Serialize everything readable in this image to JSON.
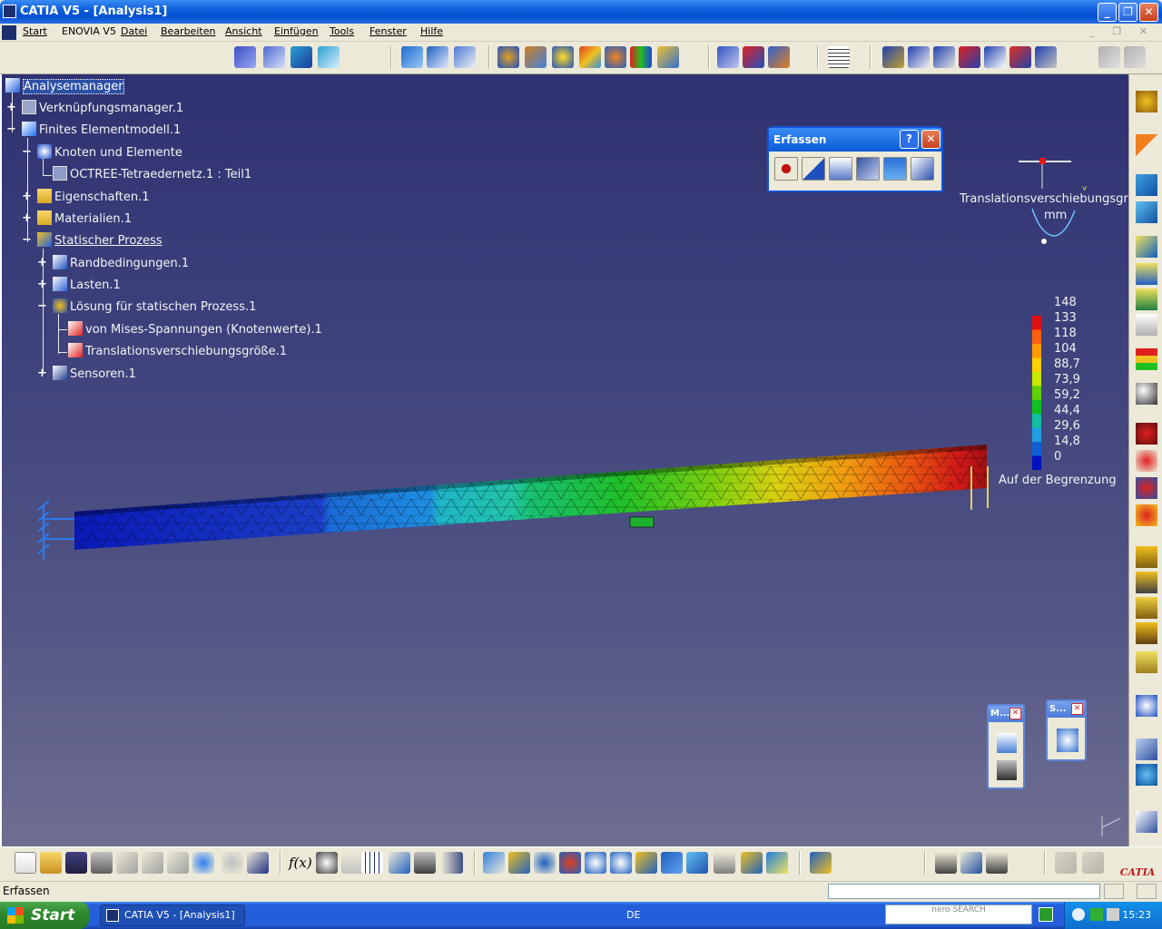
{
  "window": {
    "title": "CATIA V5 - [Analysis1]"
  },
  "menu": [
    "Start",
    "ENOVIA V5",
    "Datei",
    "Bearbeiten",
    "Ansicht",
    "Einfügen",
    "Tools",
    "Fenster",
    "Hilfe"
  ],
  "tree": [
    {
      "label": "Analysemanager",
      "icon": "analysis-manager-icon"
    },
    {
      "label": "Verknüpfungsmanager.1",
      "icon": "links-manager-icon"
    },
    {
      "label": "Finites Elementmodell.1",
      "icon": "fem-model-icon"
    },
    {
      "label": "Knoten und Elemente",
      "icon": "nodes-elements-icon"
    },
    {
      "label": "OCTREE-Tetraedernetz.1 : Teil1",
      "icon": "mesh-icon"
    },
    {
      "label": "Eigenschaften.1",
      "icon": "folder-icon"
    },
    {
      "label": "Materialien.1",
      "icon": "folder-icon"
    },
    {
      "label": "Statischer Prozess",
      "icon": "static-case-icon"
    },
    {
      "label": "Randbedingungen.1",
      "icon": "restraints-icon"
    },
    {
      "label": "Lasten.1",
      "icon": "loads-icon"
    },
    {
      "label": "Lösung für statischen Prozess.1",
      "icon": "solution-icon"
    },
    {
      "label": "von Mises-Spannungen (Knotenwerte).1",
      "icon": "image-icon"
    },
    {
      "label": "Translationsverschiebungsgröße.1",
      "icon": "image-icon"
    },
    {
      "label": "Sensoren.1",
      "icon": "sensors-icon"
    }
  ],
  "erfassen_toolbar": {
    "title": "Erfassen",
    "help": "?",
    "close": "✕"
  },
  "legend": {
    "title": "Translationsverschiebungsgröß",
    "unit": "mm",
    "values": [
      "148",
      "133",
      "118",
      "104",
      "88,7",
      "73,9",
      "59,2",
      "44,4",
      "29,6",
      "14,8",
      "0"
    ],
    "colors": [
      "#e01010",
      "#ff6010",
      "#ff9a00",
      "#ffd000",
      "#c8e800",
      "#60d000",
      "#10c020",
      "#10c0a0",
      "#20a0e0",
      "#1060d8",
      "#0010c0"
    ],
    "footer": "Auf der Begrenzung"
  },
  "mini_toolbars": [
    {
      "title": "M...",
      "close": "✕"
    },
    {
      "title": "S...",
      "close": "✕"
    }
  ],
  "status": {
    "text": "Erfassen"
  },
  "taskbar": {
    "start": "Start",
    "task": "CATIA V5 - [Analysis1]",
    "lang": "DE",
    "nero": "nero SEARCH",
    "time": "15:23"
  }
}
